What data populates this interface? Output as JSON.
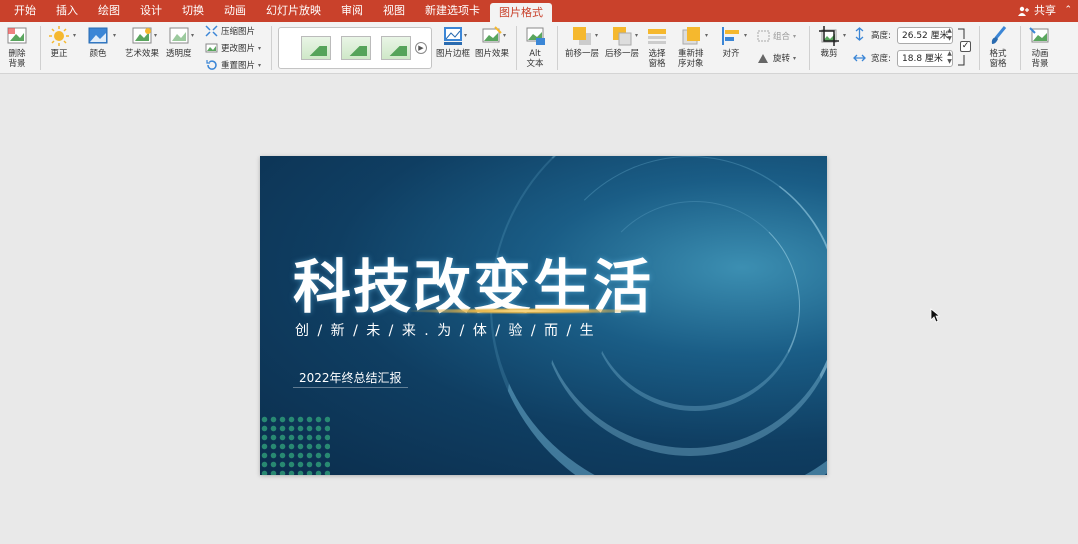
{
  "menu": {
    "tabs": [
      "开始",
      "插入",
      "绘图",
      "设计",
      "切换",
      "动画",
      "幻灯片放映",
      "审阅",
      "视图",
      "新建选项卡",
      "图片格式"
    ],
    "active_tab": "图片格式",
    "share_label": "共享"
  },
  "ribbon": {
    "remove_bg": "删除\n背景",
    "corrections": "更正",
    "color": "颜色",
    "artistic": "艺术效果",
    "transparency": "透明度",
    "compress": "压缩图片",
    "change_picture": "更改图片",
    "reset_picture": "重置图片",
    "picture_border": "图片边框",
    "picture_effects": "图片效果",
    "alt_text": "Alt\n文本",
    "bring_forward": "前移一层",
    "send_backward": "后移一层",
    "selection_pane": "选择\n窗格",
    "reorder": "重新排\n序对象",
    "align": "对齐",
    "group": "组合",
    "rotate": "旋转",
    "crop": "裁剪",
    "height_label": "高度:",
    "height_value": "26.52 厘米",
    "width_label": "宽度:",
    "width_value": "18.8 厘米",
    "lock_aspect": true,
    "format_pane": "格式\n窗格",
    "animation_bg": "动画\n背景"
  },
  "slide": {
    "title": "科技改变生活",
    "subtitle": "创 / 新 / 未 / 来 . 为 / 体 / 验 / 而 / 生",
    "report": "2022年终总结汇报"
  },
  "colors": {
    "menubar": "#c9412b",
    "ribbon": "#f3f3f3",
    "canvas": "#e9e9e9",
    "slide_dark": "#0b2d4c",
    "slide_light": "#3c8fb2",
    "accent_yellow": "#f5b82e"
  }
}
